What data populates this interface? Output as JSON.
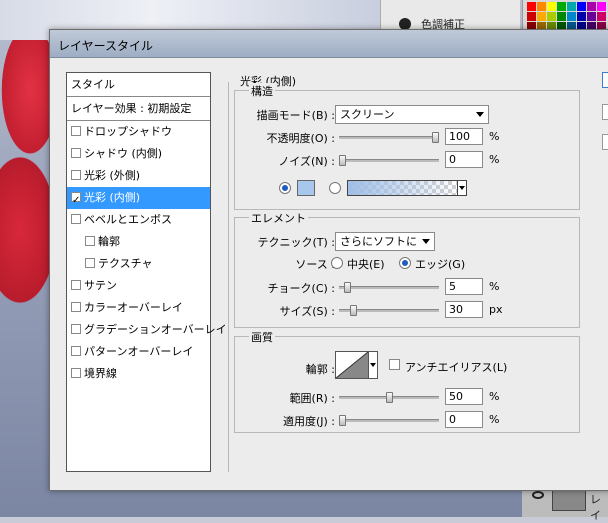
{
  "background": {
    "panel_text": "色調補正",
    "layer_text": "レイ",
    "swatch_colors": [
      "#ff0000",
      "#ff8800",
      "#ffff00",
      "#00aa00",
      "#00aaaa",
      "#0000ff",
      "#aa00aa",
      "#ff00ff",
      "#cc0000",
      "#ffaa00",
      "#aacc00",
      "#008800",
      "#0088cc",
      "#0000aa",
      "#660099",
      "#cc0066",
      "#880000",
      "#996600",
      "#668800",
      "#005500",
      "#005588",
      "#000088",
      "#440066",
      "#880044",
      "#ff6666",
      "#ffcc66",
      "#ffff99",
      "#66cc66",
      "#66cccc",
      "#6666ff",
      "#cc66cc",
      "#ff99cc"
    ]
  },
  "dialog": {
    "title": "レイヤースタイル",
    "style_list": [
      {
        "label": "スタイル",
        "header": true
      },
      {
        "label": "レイヤー効果 : 初期設定",
        "header": true
      },
      {
        "label": "ドロップシャドウ",
        "checked": false
      },
      {
        "label": "シャドウ (内側)",
        "checked": false
      },
      {
        "label": "光彩 (外側)",
        "checked": false
      },
      {
        "label": "光彩 (内側)",
        "checked": true,
        "selected": true
      },
      {
        "label": "ベベルとエンボス",
        "checked": false
      },
      {
        "label": "輪郭",
        "checked": false,
        "indent": true
      },
      {
        "label": "テクスチャ",
        "checked": false,
        "indent": true
      },
      {
        "label": "サテン",
        "checked": false
      },
      {
        "label": "カラーオーバーレイ",
        "checked": false
      },
      {
        "label": "グラデーションオーバーレイ",
        "checked": false
      },
      {
        "label": "パターンオーバーレイ",
        "checked": false
      },
      {
        "label": "境界線",
        "checked": false
      }
    ],
    "panel_title": "光彩 (内側)",
    "structure": {
      "title": "構造",
      "blend_mode_label": "描画モード(B) :",
      "blend_mode_value": "スクリーン",
      "opacity_label": "不透明度(O) :",
      "opacity_value": "100",
      "opacity_unit": "%",
      "opacity_fraction": 1.0,
      "noise_label": "ノイズ(N) :",
      "noise_value": "0",
      "noise_unit": "%",
      "noise_fraction": 0.0,
      "glow_color": "#a9c6ec"
    },
    "elements": {
      "title": "エレメント",
      "technique_label": "テクニック(T) :",
      "technique_value": "さらにソフトに",
      "source_label": "ソース :",
      "source_center": "中央(E)",
      "source_edge": "エッジ(G)",
      "choke_label": "チョーク(C) :",
      "choke_value": "5",
      "choke_unit": "%",
      "choke_fraction": 0.05,
      "size_label": "サイズ(S) :",
      "size_value": "30",
      "size_unit": "px",
      "size_fraction": 0.12
    },
    "quality": {
      "title": "画質",
      "contour_label": "輪郭 :",
      "antialias_label": "アンチエイリアス(L)",
      "range_label": "範囲(R) :",
      "range_value": "50",
      "range_unit": "%",
      "range_fraction": 0.5,
      "jitter_label": "適用度(J) :",
      "jitter_value": "0",
      "jitter_unit": "%",
      "jitter_fraction": 0.0
    }
  }
}
